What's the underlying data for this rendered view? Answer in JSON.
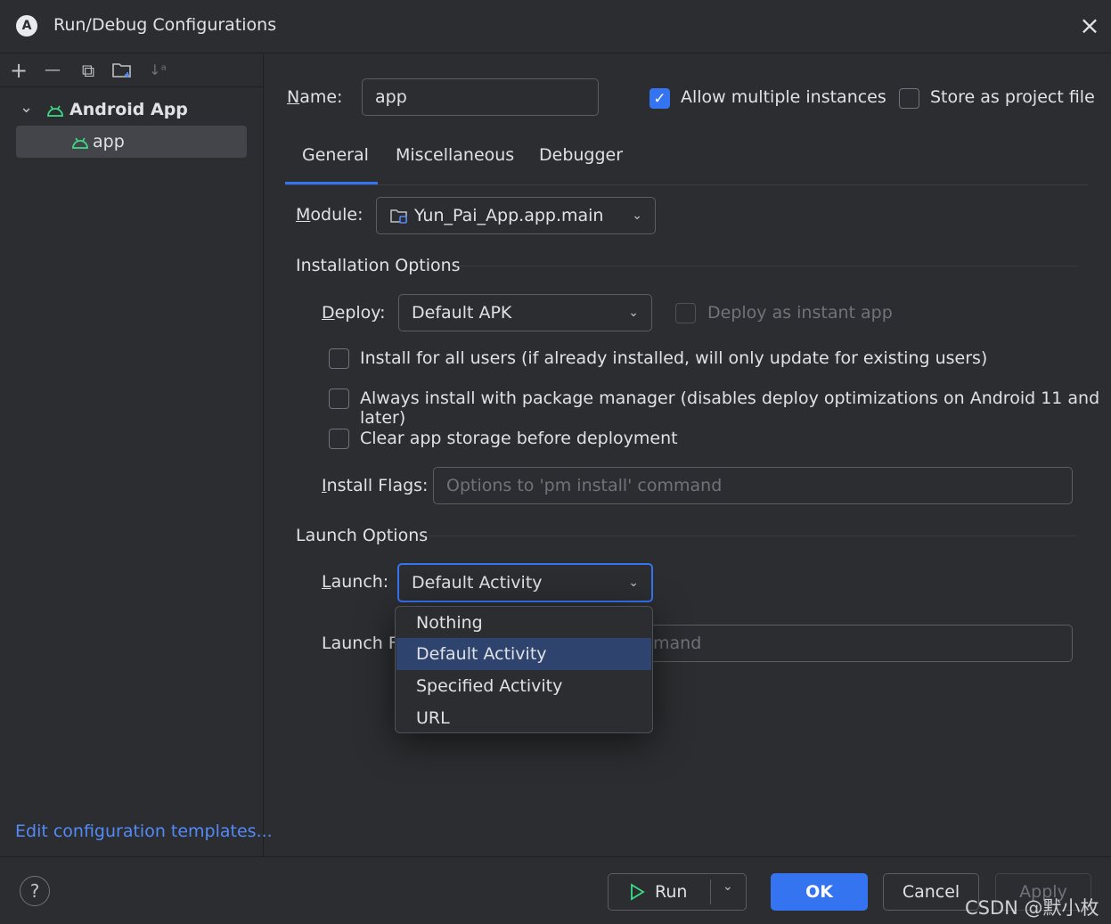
{
  "window": {
    "title": "Run/Debug Configurations",
    "logo_letter": "A"
  },
  "toolbar": {
    "add": "+",
    "remove": "—",
    "copy": "⧉",
    "folder": "🗀",
    "sort": "↓ᵃ"
  },
  "tree": {
    "group_label": "Android App",
    "item_label": "app",
    "expand_glyph": "⌄",
    "android_glyph": "ᓚ"
  },
  "edit_templates_link": "Edit configuration templates...",
  "name_field": {
    "label": "Name:",
    "value": "app"
  },
  "allow_multiple": {
    "label": "Allow multiple instances",
    "checked": true
  },
  "store_project": {
    "label": "Store as project file",
    "checked": false
  },
  "tabs": [
    "General",
    "Miscellaneous",
    "Debugger"
  ],
  "active_tab": "General",
  "module": {
    "label": "Module:",
    "value": "Yun_Pai_App.app.main"
  },
  "installation": {
    "section_title": "Installation Options",
    "deploy_label": "Deploy:",
    "deploy_value": "Default APK",
    "instant_app_label": "Deploy as instant app",
    "install_all_users": "Install for all users (if already installed, will only update for existing users)",
    "always_pkg_manager": "Always install with package manager (disables deploy optimizations on Android 11 and later)",
    "clear_storage": "Clear app storage before deployment",
    "install_flags_label": "Install Flags:",
    "install_flags_placeholder": "Options to 'pm install' command"
  },
  "launch": {
    "section_title": "Launch Options",
    "launch_label": "Launch:",
    "launch_value": "Default Activity",
    "launch_flags_label_visible": "Launch Fl",
    "launch_flags_placeholder_visible": "mand",
    "options": [
      "Nothing",
      "Default Activity",
      "Specified Activity",
      "URL"
    ],
    "selected_option": "Default Activity"
  },
  "buttons": {
    "run": "Run",
    "ok": "OK",
    "cancel": "Cancel",
    "apply": "Apply",
    "help": "?"
  },
  "watermark": "CSDN @默小枚",
  "colors": {
    "accent": "#3574f0",
    "android_green": "#3ddc84",
    "link": "#548af7",
    "background": "#2b2d30"
  }
}
